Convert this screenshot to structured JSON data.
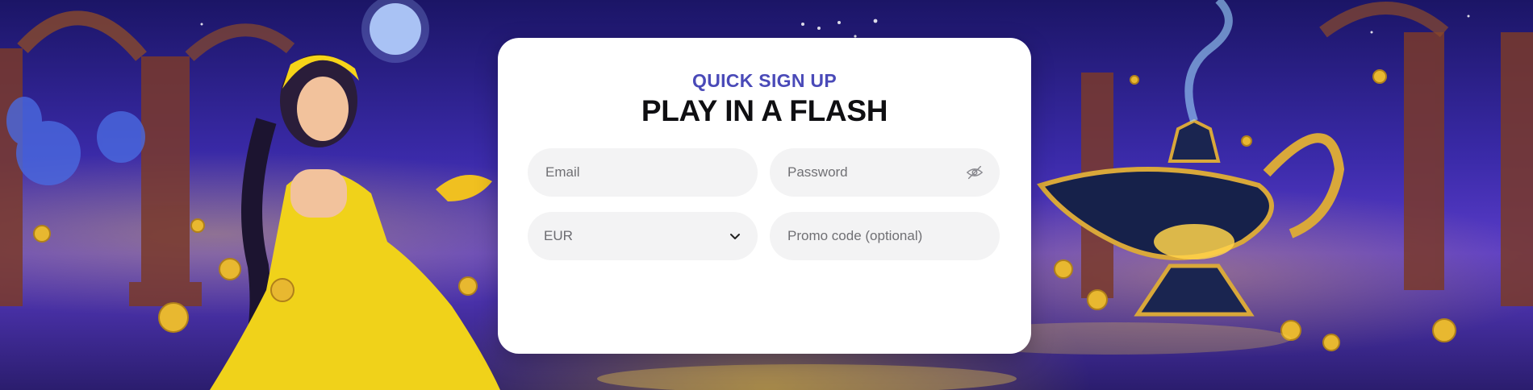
{
  "form": {
    "kicker": "QUICK SIGN UP",
    "headline": "PLAY IN A FLASH",
    "email": {
      "value": "",
      "placeholder": "Email"
    },
    "password": {
      "value": "",
      "placeholder": "Password",
      "toggle_icon": "eye-off-icon"
    },
    "currency": {
      "selected": "EUR",
      "icon": "chevron-down-icon"
    },
    "promo": {
      "value": "",
      "placeholder": "Promo code (optional)"
    }
  },
  "colors": {
    "kicker": "#4a4ab8",
    "headline": "#0f0f12",
    "field_bg": "#f3f3f4",
    "card_bg": "#ffffff"
  }
}
